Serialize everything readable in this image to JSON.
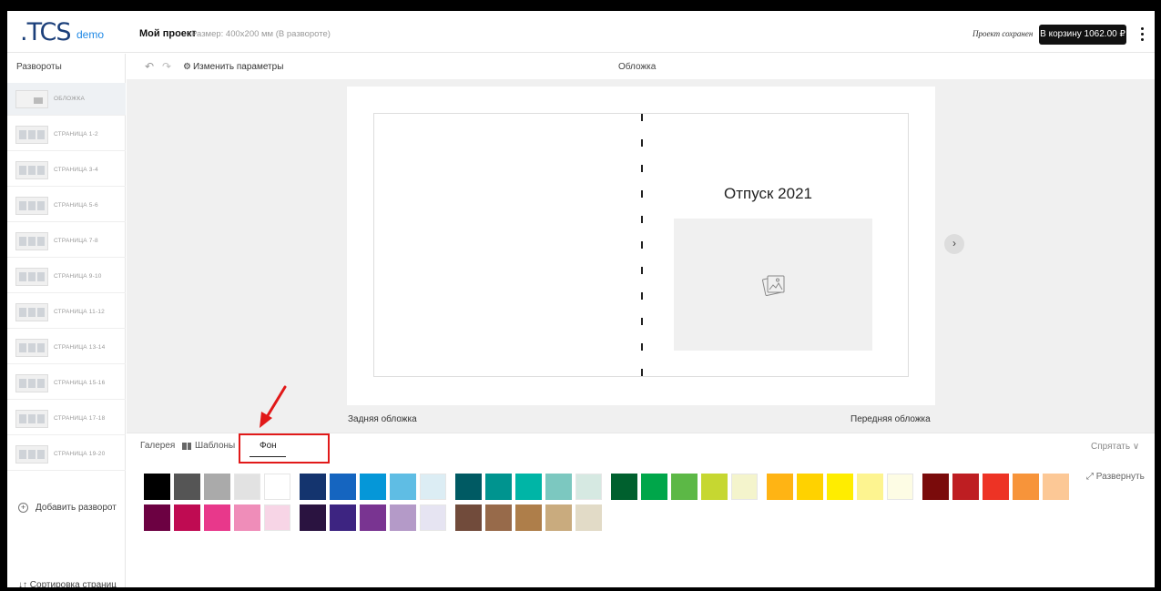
{
  "header": {
    "logo": ".TCS",
    "logo_suffix": "demo",
    "project_name": "Мой проект",
    "project_size": "Размер: 400x200 мм (В развороте)",
    "saved_status": "Проект сохранен",
    "cart_button": "В корзину 1062.00 ₽"
  },
  "sidebar": {
    "title": "Развороты",
    "items": [
      {
        "label": "ОБЛОЖКА",
        "active": true
      },
      {
        "label": "СТРАНИЦА 1-2"
      },
      {
        "label": "СТРАНИЦА 3-4"
      },
      {
        "label": "СТРАНИЦА 5-6"
      },
      {
        "label": "СТРАНИЦА 7-8"
      },
      {
        "label": "СТРАНИЦА 9-10"
      },
      {
        "label": "СТРАНИЦА 11-12"
      },
      {
        "label": "СТРАНИЦА 13-14"
      },
      {
        "label": "СТРАНИЦА 15-16"
      },
      {
        "label": "СТРАНИЦА 17-18"
      },
      {
        "label": "СТРАНИЦА 19-20"
      }
    ],
    "add_spread": "Добавить разворот",
    "sort_pages": "Сортировка страниц"
  },
  "toolbar": {
    "change_params": "Изменить параметры",
    "current_spread": "Обложка"
  },
  "canvas": {
    "title_text": "Отпуск 2021",
    "back_cover_label": "Задняя обложка",
    "front_cover_label": "Передняя обложка"
  },
  "panel": {
    "tabs": [
      "Галерея",
      "Шаблоны",
      "Фон"
    ],
    "active_tab": "Фон",
    "hide_button": "Спрятать",
    "expand_button": "Развернуть",
    "swatch_rows": [
      [
        [
          "#000000",
          "#555555",
          "#aaaaaa",
          "#e2e2e2",
          "#ffffff"
        ],
        [
          "#14346e",
          "#1565c0",
          "#0597d8",
          "#5fbde4",
          "#dcedf4"
        ],
        [
          "#005a63",
          "#00948f",
          "#00b5a6",
          "#7cc8c0",
          "#d6e9e2"
        ],
        [
          "#00602e",
          "#00a64a",
          "#5cb846",
          "#c6d731",
          "#f4f4cc"
        ],
        [
          "#ffb414",
          "#ffd200",
          "#ffed00",
          "#fdf490",
          "#fdfce4"
        ],
        [
          "#7a0b0b",
          "#be1e22",
          "#ed3325",
          "#f7943a",
          "#fcc896"
        ]
      ],
      [
        [
          "#6c0142",
          "#bf0b52",
          "#e8388b",
          "#ef8db9",
          "#f7d5e6"
        ],
        [
          "#2a1340",
          "#3d2481",
          "#793491",
          "#b49ac8",
          "#e6e4f2"
        ],
        [
          "#714b3b",
          "#976a4a",
          "#ae7e4a",
          "#c9ab7e",
          "#e2dbc7"
        ]
      ]
    ]
  }
}
